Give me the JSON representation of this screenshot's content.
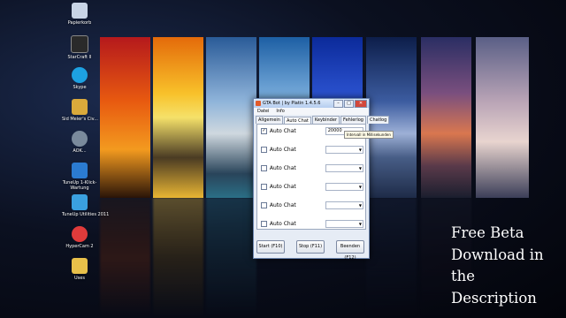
{
  "desktop_icons": [
    {
      "label": "Papierkorb",
      "icon": "recycle-bin-icon",
      "color": "#c8d4e6"
    },
    {
      "label": "StarCraft II",
      "icon": "starcraft-icon",
      "color": "#2a2a2a"
    },
    {
      "label": "Skype",
      "icon": "skype-icon",
      "color": "#1da1e2"
    },
    {
      "label": "Sid Meier's Civ...",
      "icon": "folder-icon",
      "color": "#d9a93b"
    },
    {
      "label": "AOK...",
      "icon": "disc-icon",
      "color": "#7a8a9c"
    },
    {
      "label": "TuneUp 1-Klick-Wartung",
      "icon": "tuneup-icon",
      "color": "#2b7bd1"
    },
    {
      "label": "TuneUp Utilities 2011",
      "icon": "tuneup-utilities-icon",
      "color": "#3aa0e0"
    },
    {
      "label": "HyperCam 2",
      "icon": "hypercam-icon",
      "color": "#e03b3b"
    },
    {
      "label": "Uses",
      "icon": "folder-icon",
      "color": "#e8c04a"
    }
  ],
  "window": {
    "title": "GTA Bot | by Platin 1.4.5.6",
    "controls": {
      "minimize": "–",
      "maximize": "□",
      "close": "✕"
    },
    "menu": [
      "Datei",
      "Info"
    ],
    "tabs": [
      "Allgemein",
      "Auto Chat",
      "Keybinder",
      "Fehlerlog",
      "Chatlog"
    ],
    "active_tab": "Auto Chat",
    "rows": [
      {
        "label": "Auto Chat",
        "checked": true,
        "value": "20000"
      },
      {
        "label": "Auto Chat",
        "checked": false,
        "value": ""
      },
      {
        "label": "Auto Chat",
        "checked": false,
        "value": ""
      },
      {
        "label": "Auto Chat",
        "checked": false,
        "value": ""
      },
      {
        "label": "Auto Chat",
        "checked": false,
        "value": ""
      },
      {
        "label": "Auto Chat",
        "checked": false,
        "value": ""
      }
    ],
    "tooltip": "Intervall in Millisekunden",
    "buttons": {
      "start": "Start (F10)",
      "stop": "Stop (F11)",
      "exit": "Beenden (F12)"
    }
  },
  "promo_lines": [
    "Free Beta",
    "Download in",
    "the",
    "Description"
  ]
}
